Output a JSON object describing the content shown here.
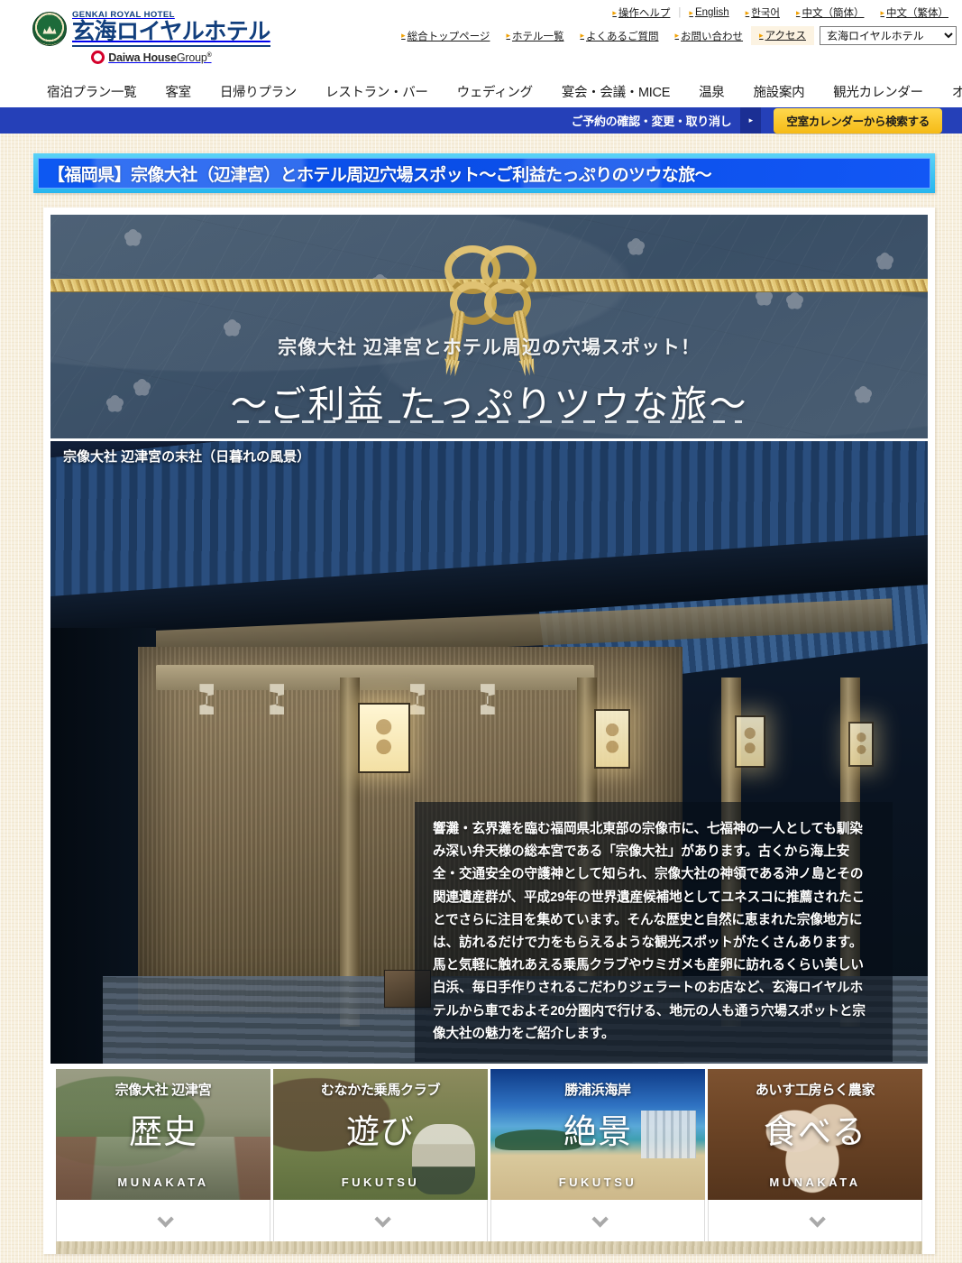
{
  "header": {
    "logo": {
      "english": "GENKAI ROYAL HOTEL",
      "japanese": "玄海ロイヤルホテル",
      "group_bold": "Daiwa House",
      "group_thin": "Group",
      "group_reg": "®"
    },
    "utility_top": [
      {
        "label": "操作ヘルプ"
      },
      {
        "label": "English"
      },
      {
        "label": "한국어"
      },
      {
        "label": "中文（簡体）"
      },
      {
        "label": "中文（繁体）"
      }
    ],
    "utility_second": [
      {
        "label": "総合トップページ"
      },
      {
        "label": "ホテル一覧"
      },
      {
        "label": "よくあるご質問"
      },
      {
        "label": "お問い合わせ"
      },
      {
        "label": "アクセス"
      }
    ],
    "hotel_select": {
      "selected": "玄海ロイヤルホテル",
      "options": [
        "玄海ロイヤルホテル"
      ]
    },
    "main_nav": [
      {
        "label": "宿泊プラン一覧"
      },
      {
        "label": "客室"
      },
      {
        "label": "日帰りプラン"
      },
      {
        "label": "レストラン・バー"
      },
      {
        "label": "ウェディング"
      },
      {
        "label": "宴会・会議・MICE"
      },
      {
        "label": "温泉"
      },
      {
        "label": "施設案内"
      },
      {
        "label": "観光カレンダー"
      },
      {
        "label": "オンラインショップ"
      }
    ]
  },
  "reservation_bar": {
    "confirm_label": "ご予約の確認・変更・取り消し",
    "arrow_glyph": "▸",
    "cta_label": "空室カレンダーから検索する",
    "bar_color": "#2540b8",
    "cta_color": "#f5ba16"
  },
  "page_title": {
    "text": "【福岡県】宗像大社（辺津宮）とホテル周辺穴場スポット〜ご利益たっぷりのツウな旅〜",
    "frame_color": "#27b6ee",
    "fill_color": "#0a54f0"
  },
  "hero": {
    "subtitle": "宗像大社 辺津宮とホテル周辺の穴場スポット！",
    "title": "〜ご利益 たっぷりツウな旅〜",
    "background_color": "#3f546a",
    "rope_color": "#d9bb6b"
  },
  "photo": {
    "caption": "宗像大社 辺津宮の末社（日暮れの風景）",
    "description": "響灘・玄界灘を臨む福岡県北東部の宗像市に、七福神の一人としても馴染み深い弁天様の総本宮である「宗像大社」があります。古くから海上安全・交通安全の守護神として知られ、宗像大社の神領である沖ノ島とその関連遺産群が、平成29年の世界遺産候補地としてユネスコに推薦されたことでさらに注目を集めています。そんな歴史と自然に恵まれた宗像地方には、訪れるだけで力をもらえるような観光スポットがたくさんあります。馬と気軽に触れあえる乗馬クラブやウミガメも産卵に訪れるくらい美しい白浜、毎日手作りされるこだわりジェラートのお店など、玄海ロイヤルホテルから車でおよそ20分圏内で行ける、地元の人も通う穴場スポットと宗像大社の魅力をご紹介します。"
  },
  "cards": [
    {
      "title": "宗像大社 辺津宮",
      "big": "歴史",
      "region": "MUNAKATA",
      "arrow": "chevron-down"
    },
    {
      "title": "むなかた乗馬クラブ",
      "big": "遊び",
      "region": "FUKUTSU",
      "arrow": "chevron-down"
    },
    {
      "title": "勝浦浜海岸",
      "big": "絶景",
      "region": "FUKUTSU",
      "arrow": "chevron-down"
    },
    {
      "title": "あいす工房らく農家",
      "big": "食べる",
      "region": "MUNAKATA",
      "arrow": "chevron-down"
    }
  ]
}
